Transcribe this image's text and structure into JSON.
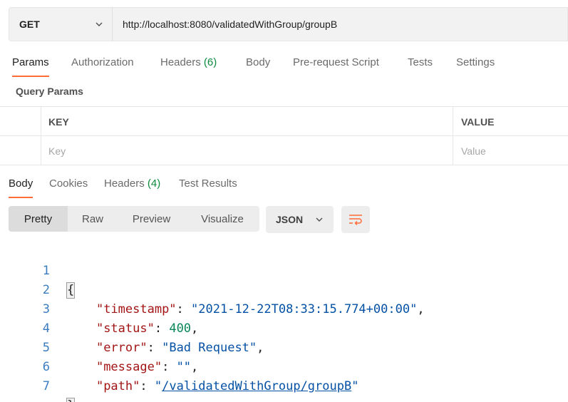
{
  "request": {
    "method": "GET",
    "url": "http://localhost:8080/validatedWithGroup/groupB"
  },
  "request_tabs": [
    {
      "label": "Params",
      "count": ""
    },
    {
      "label": "Authorization",
      "count": ""
    },
    {
      "label": "Headers",
      "count": "(6)"
    },
    {
      "label": "Body",
      "count": ""
    },
    {
      "label": "Pre-request Script",
      "count": ""
    },
    {
      "label": "Tests",
      "count": ""
    },
    {
      "label": "Settings",
      "count": ""
    }
  ],
  "query_params": {
    "title": "Query Params",
    "key_header": "KEY",
    "value_header": "VALUE",
    "key_placeholder": "Key",
    "value_placeholder": "Value"
  },
  "response_tabs": [
    {
      "label": "Body",
      "count": ""
    },
    {
      "label": "Cookies",
      "count": ""
    },
    {
      "label": "Headers",
      "count": "(4)"
    },
    {
      "label": "Test Results",
      "count": ""
    }
  ],
  "view_modes": [
    "Pretty",
    "Raw",
    "Preview",
    "Visualize"
  ],
  "format": "JSON",
  "colors": {
    "accent": "#ff6c37",
    "count_green": "#0d8a3b",
    "json_key": "#a31515",
    "json_string": "#0451a5",
    "json_number": "#098658",
    "line_number": "#3a7cbf"
  },
  "response_body": {
    "line_numbers": [
      "1",
      "2",
      "3",
      "4",
      "5",
      "6",
      "7"
    ],
    "open_brace": "{",
    "close_brace": "}",
    "fields": [
      {
        "key": "\"timestamp\"",
        "value": "\"2021-12-22T08:33:15.774+00:00\"",
        "type": "string",
        "trail": ","
      },
      {
        "key": "\"status\"",
        "value": "400",
        "type": "number",
        "trail": ","
      },
      {
        "key": "\"error\"",
        "value": "\"Bad Request\"",
        "type": "string",
        "trail": ","
      },
      {
        "key": "\"message\"",
        "value": "\"\"",
        "type": "string",
        "trail": ","
      },
      {
        "key": "\"path\"",
        "value_prefix": "\"",
        "value_link": "/validatedWithGroup/groupB",
        "value_suffix": "\"",
        "type": "link",
        "trail": ""
      }
    ]
  }
}
